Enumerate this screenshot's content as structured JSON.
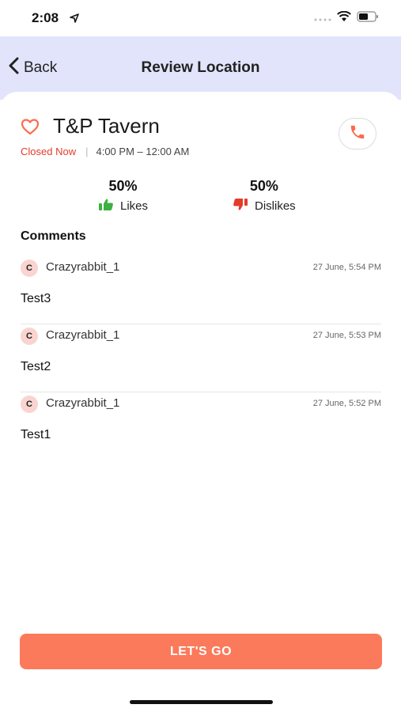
{
  "status_bar": {
    "time": "2:08"
  },
  "nav": {
    "back_label": "Back",
    "title": "Review Location"
  },
  "location": {
    "name": "T&P Tavern",
    "status": "Closed Now",
    "separator": "|",
    "hours": "4:00 PM – 12:00 AM"
  },
  "stats": {
    "likes": {
      "percent": "50%",
      "label": "Likes"
    },
    "dislikes": {
      "percent": "50%",
      "label": "Dislikes"
    }
  },
  "comments_heading": "Comments",
  "comments": [
    {
      "avatar": "C",
      "user": "Crazyrabbit_1",
      "time": "27 June, 5:54 PM",
      "text": "Test3"
    },
    {
      "avatar": "C",
      "user": "Crazyrabbit_1",
      "time": "27 June, 5:53 PM",
      "text": "Test2"
    },
    {
      "avatar": "C",
      "user": "Crazyrabbit_1",
      "time": "27 June, 5:52 PM",
      "text": "Test1"
    }
  ],
  "cta": {
    "label": "LET'S GO"
  },
  "colors": {
    "accent": "#fb7a5b",
    "nav_bg": "#e1e4fb",
    "closed": "#e23c2a",
    "like": "#3cb043",
    "dislike": "#e23c2a"
  },
  "icons": [
    "location-arrow-icon",
    "signal-icon",
    "wifi-icon",
    "battery-icon",
    "chevron-left-icon",
    "heart-icon",
    "phone-icon",
    "thumbs-up-icon",
    "thumbs-down-icon"
  ]
}
